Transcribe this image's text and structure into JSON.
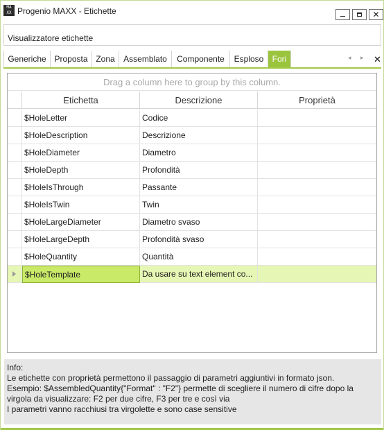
{
  "window": {
    "title": "Progenio MAXX - Etichette",
    "logo_top": "MA",
    "logo_bottom": "XX",
    "min_label": "",
    "max_label": "",
    "close_label": "✕",
    "accent_color": "#9bc43d"
  },
  "header": {
    "label": "Visualizzatore etichette"
  },
  "tabs": [
    {
      "label": "Generiche",
      "active": false
    },
    {
      "label": "Proposta",
      "active": false
    },
    {
      "label": "Zona",
      "active": false
    },
    {
      "label": "Assemblato",
      "active": false
    },
    {
      "label": "Componente",
      "active": false
    },
    {
      "label": "Esploso",
      "active": false
    },
    {
      "label": "Fori",
      "active": true
    }
  ],
  "tab_nav": {
    "prev_icon": "◂",
    "next_icon": "▸",
    "close_icon": "✕"
  },
  "grid": {
    "group_panel_text": "Drag a column here to group by this column.",
    "columns": [
      "Etichetta",
      "Descrizione",
      "Proprietà"
    ],
    "rows": [
      {
        "etichetta": "$HoleLetter",
        "descrizione": "Codice",
        "proprieta": ""
      },
      {
        "etichetta": "$HoleDescription",
        "descrizione": "Descrizione",
        "proprieta": ""
      },
      {
        "etichetta": "$HoleDiameter",
        "descrizione": "Diametro",
        "proprieta": ""
      },
      {
        "etichetta": "$HoleDepth",
        "descrizione": "Profondità",
        "proprieta": ""
      },
      {
        "etichetta": "$HoleIsThrough",
        "descrizione": "Passante",
        "proprieta": ""
      },
      {
        "etichetta": "$HoleIsTwin",
        "descrizione": "Twin",
        "proprieta": ""
      },
      {
        "etichetta": "$HoleLargeDiameter",
        "descrizione": "Diametro svaso",
        "proprieta": ""
      },
      {
        "etichetta": "$HoleLargeDepth",
        "descrizione": "Profondità svaso",
        "proprieta": ""
      },
      {
        "etichetta": "$HoleQuantity",
        "descrizione": "Quantità",
        "proprieta": ""
      },
      {
        "etichetta": "$HoleTemplate",
        "descrizione": "Da usare su text element co...",
        "proprieta": "",
        "selected": true
      }
    ]
  },
  "info": {
    "lines": [
      "Info:",
      "Le etichette con proprietà permettono il passaggio di parametri aggiuntivi in formato json.",
      "Esempio: $AssembledQuantity{\"Format\" : \"F2\"} permette di scegliere il numero di cifre dopo la",
      "virgola da visualizzare: F2 per due cifre, F3 per tre e così via",
      "I parametri vanno racchiusi tra virgolette e sono case sensitive"
    ]
  }
}
